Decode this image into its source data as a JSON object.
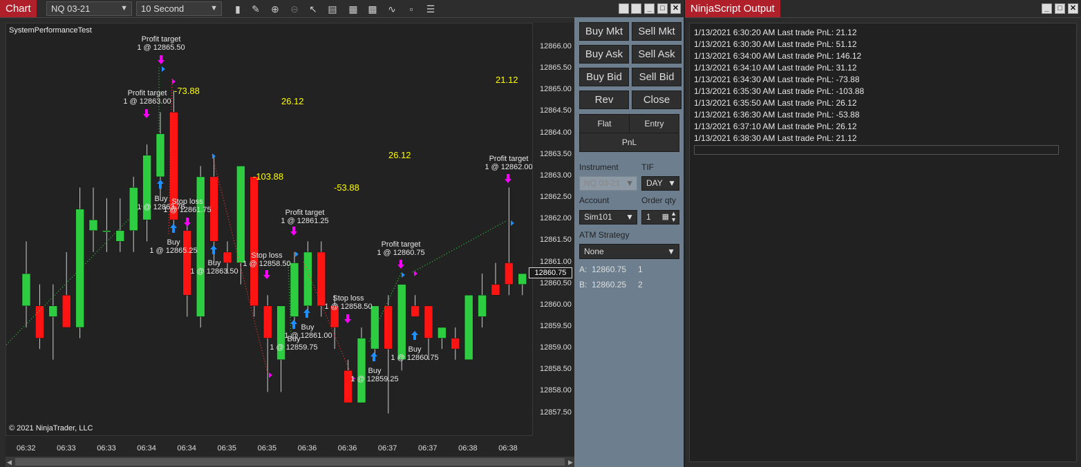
{
  "chart_window": {
    "title": "Chart",
    "instrument": "NQ 03-21",
    "interval": "10 Second",
    "strategy_label": "SystemPerformanceTest",
    "copyright": "© 2021 NinjaTrader, LLC",
    "current_price": "12860.75"
  },
  "toolbar_icons": [
    "bar-chart-icon",
    "pencil-icon",
    "zoom-in-icon",
    "zoom-out-icon",
    "pointer-icon",
    "properties-icon",
    "data-box-icon",
    "strategies-icon",
    "indicators-icon",
    "templates-icon",
    "menu-icon"
  ],
  "pnl_annotations": [
    "-73.88",
    "26.12",
    "-103.88",
    "-53.88",
    "26.12",
    "21.12"
  ],
  "trade_labels": [
    "Profit target",
    "1 @ 12865.50",
    "Profit target",
    "1 @ 12863.00",
    "Buy",
    "1 @ 12863.75",
    "Stop loss",
    "1 @ 12861.75",
    "Buy",
    "1 @ 12865.25",
    "Buy",
    "1 @ 12863.50",
    "Stop loss",
    "1 @ 12858.50",
    "Profit target",
    "1 @ 12861.25",
    "Buy",
    "1 @ 12861.00",
    "Buy",
    "1 @ 12859.75",
    "Stop loss",
    "1 @ 12858.50",
    "Buy",
    "1 @ 12859.25",
    "Profit target",
    "1 @ 12860.75",
    "Buy",
    "1 @ 12860.75",
    "Profit target",
    "1 @ 12862.00"
  ],
  "chart_data": {
    "type": "candlestick",
    "title": "SystemPerformanceTest",
    "instrument": "NQ 03-21",
    "interval": "10 Second",
    "ylim": [
      12857.25,
      12867.0
    ],
    "y_ticks": [
      "12866.00",
      "12865.50",
      "12865.00",
      "12864.50",
      "12864.00",
      "12863.50",
      "12863.00",
      "12862.50",
      "12862.00",
      "12861.50",
      "12861.00",
      "12860.50",
      "12860.00",
      "12859.50",
      "12859.00",
      "12858.50",
      "12858.00",
      "12857.50"
    ],
    "x_ticks": [
      "06:32",
      "06:33",
      "06:33",
      "06:34",
      "06:34",
      "06:35",
      "06:35",
      "06:36",
      "06:36",
      "06:37",
      "06:37",
      "06:38",
      "06:38"
    ],
    "candles": [
      {
        "o": 12860.0,
        "h": 12861.5,
        "l": 12859.5,
        "c": 12860.75
      },
      {
        "o": 12860.0,
        "h": 12860.5,
        "l": 12859.0,
        "c": 12859.25
      },
      {
        "o": 12859.75,
        "h": 12860.5,
        "l": 12858.75,
        "c": 12860.0
      },
      {
        "o": 12860.25,
        "h": 12861.25,
        "l": 12859.5,
        "c": 12859.5
      },
      {
        "o": 12859.5,
        "h": 12862.75,
        "l": 12859.25,
        "c": 12862.25
      },
      {
        "o": 12861.75,
        "h": 12862.75,
        "l": 12861.25,
        "c": 12862.0
      },
      {
        "o": 12861.75,
        "h": 12862.5,
        "l": 12861.25,
        "c": 12861.75
      },
      {
        "o": 12861.5,
        "h": 12862.5,
        "l": 12861.25,
        "c": 12861.75
      },
      {
        "o": 12861.75,
        "h": 12863.0,
        "l": 12861.25,
        "c": 12862.75
      },
      {
        "o": 12862.0,
        "h": 12863.75,
        "l": 12861.5,
        "c": 12863.5
      },
      {
        "o": 12863.0,
        "h": 12864.5,
        "l": 12862.5,
        "c": 12864.0
      },
      {
        "o": 12864.5,
        "h": 12865.0,
        "l": 12861.75,
        "c": 12862.0
      },
      {
        "o": 12861.75,
        "h": 12862.0,
        "l": 12859.75,
        "c": 12860.25
      },
      {
        "o": 12859.75,
        "h": 12863.25,
        "l": 12859.5,
        "c": 12863.0
      },
      {
        "o": 12863.0,
        "h": 12863.5,
        "l": 12861.0,
        "c": 12861.5
      },
      {
        "o": 12861.25,
        "h": 12861.5,
        "l": 12860.75,
        "c": 12861.0
      },
      {
        "o": 12861.0,
        "h": 12863.25,
        "l": 12860.5,
        "c": 12863.25
      },
      {
        "o": 12863.0,
        "h": 12863.0,
        "l": 12859.75,
        "c": 12860.0
      },
      {
        "o": 12860.0,
        "h": 12860.25,
        "l": 12858.0,
        "c": 12859.25
      },
      {
        "o": 12858.75,
        "h": 12860.0,
        "l": 12858.0,
        "c": 12860.0
      },
      {
        "o": 12859.75,
        "h": 12861.25,
        "l": 12859.5,
        "c": 12861.0
      },
      {
        "o": 12860.0,
        "h": 12861.5,
        "l": 12859.75,
        "c": 12861.25
      },
      {
        "o": 12861.25,
        "h": 12861.5,
        "l": 12859.75,
        "c": 12860.0
      },
      {
        "o": 12860.0,
        "h": 12860.25,
        "l": 12859.0,
        "c": 12859.5
      },
      {
        "o": 12858.5,
        "h": 12858.75,
        "l": 12857.75,
        "c": 12857.75
      },
      {
        "o": 12857.75,
        "h": 12859.5,
        "l": 12857.75,
        "c": 12859.25
      },
      {
        "o": 12859.0,
        "h": 12860.0,
        "l": 12858.75,
        "c": 12860.0
      },
      {
        "o": 12860.0,
        "h": 12860.25,
        "l": 12857.5,
        "c": 12859.0
      },
      {
        "o": 12858.75,
        "h": 12860.5,
        "l": 12858.5,
        "c": 12860.5
      },
      {
        "o": 12860.0,
        "h": 12860.25,
        "l": 12859.75,
        "c": 12859.75
      },
      {
        "o": 12860.0,
        "h": 12860.0,
        "l": 12858.75,
        "c": 12859.25
      },
      {
        "o": 12859.25,
        "h": 12859.5,
        "l": 12859.0,
        "c": 12859.5
      },
      {
        "o": 12859.25,
        "h": 12859.5,
        "l": 12858.75,
        "c": 12859.0
      },
      {
        "o": 12858.75,
        "h": 12859.75,
        "l": 12858.75,
        "c": 12860.25
      },
      {
        "o": 12859.75,
        "h": 12860.75,
        "l": 12859.5,
        "c": 12860.25
      },
      {
        "o": 12860.5,
        "h": 12861.0,
        "l": 12860.5,
        "c": 12860.25
      },
      {
        "o": 12861.0,
        "h": 12862.75,
        "l": 12860.25,
        "c": 12860.5
      },
      {
        "o": 12860.5,
        "h": 12860.75,
        "l": 12860.25,
        "c": 12860.75
      }
    ],
    "colors": {
      "up": "#2ecc40",
      "down": "#ff1414",
      "pnl": "#ffff00",
      "entry": "#1e90ff",
      "exit": "#ff00ff"
    }
  },
  "chart_trader": {
    "buttons": [
      "Buy Mkt",
      "Sell Mkt",
      "Buy Ask",
      "Sell Ask",
      "Buy Bid",
      "Sell Bid",
      "Rev",
      "Close"
    ],
    "flat_label": "Flat",
    "entry_label": "Entry",
    "pnl_label": "PnL",
    "instrument_label": "Instrument",
    "instrument_value": "NQ 03-21",
    "tif_label": "TIF",
    "tif_value": "DAY",
    "account_label": "Account",
    "account_value": "Sim101",
    "order_qty_label": "Order qty",
    "order_qty_value": "1",
    "atm_label": "ATM Strategy",
    "atm_value": "None",
    "ask_label": "A:",
    "ask_price": "12860.75",
    "ask_size": "1",
    "bid_label": "B:",
    "bid_price": "12860.25",
    "bid_size": "2"
  },
  "output_window": {
    "title": "NinjaScript Output",
    "lines": [
      "1/13/2021 6:30:20 AM Last trade PnL: 21.12",
      "1/13/2021 6:30:30 AM Last trade PnL: 51.12",
      "1/13/2021 6:34:00 AM Last trade PnL: 146.12",
      "1/13/2021 6:34:10 AM Last trade PnL: 31.12",
      "1/13/2021 6:34:30 AM Last trade PnL: -73.88",
      "1/13/2021 6:35:30 AM Last trade PnL: -103.88",
      "1/13/2021 6:35:50 AM Last trade PnL: 26.12",
      "1/13/2021 6:36:30 AM Last trade PnL: -53.88",
      "1/13/2021 6:37:10 AM Last trade PnL: 26.12",
      "1/13/2021 6:38:30 AM Last trade PnL: 21.12"
    ]
  }
}
